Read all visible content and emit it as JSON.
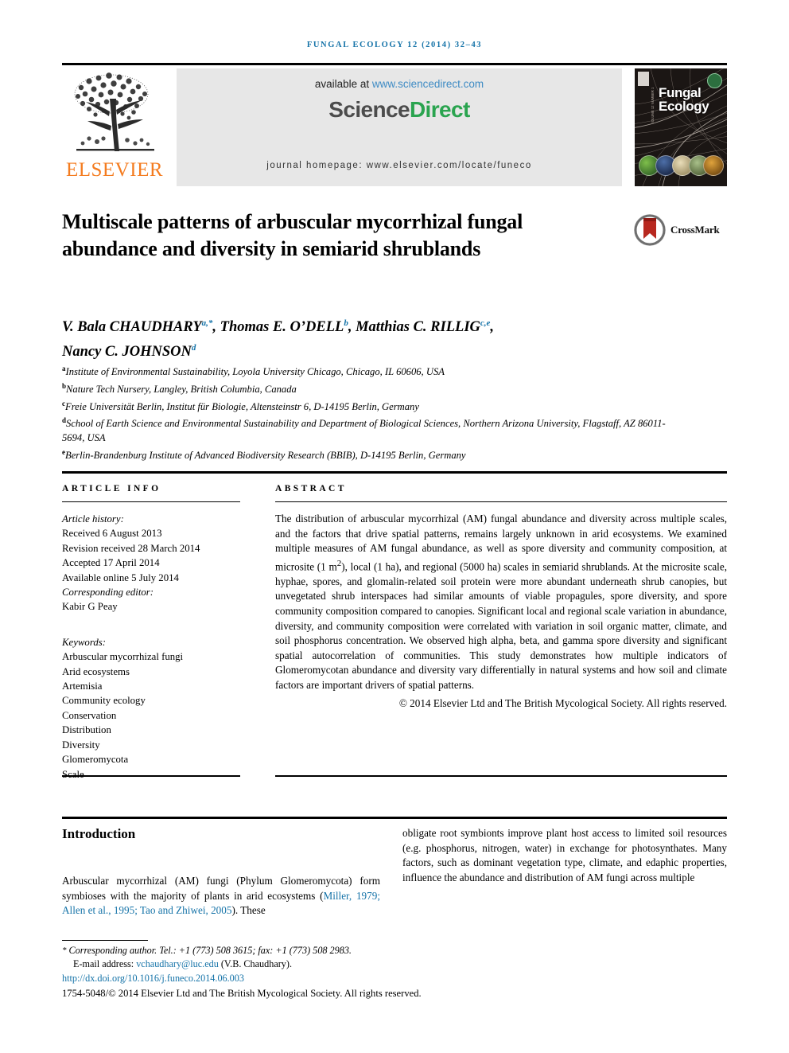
{
  "running_head": "FUNGAL ECOLOGY 12 (2014) 32–43",
  "masthead": {
    "publisher_name": "ELSEVIER",
    "publisher_logo_icon": "elsevier-tree-icon",
    "available_prefix": "available at ",
    "available_url": "www.sciencedirect.com",
    "sciencedirect_part1": "Science",
    "sciencedirect_part2": "Direct",
    "journal_homepage": "journal homepage: www.elsevier.com/locate/funeco",
    "cover": {
      "title_line1": "Fungal",
      "title_line2": "Ecology",
      "spine_text": "VOLUME 12 NUMBER 1 FEBRUARY 2014",
      "publisher_mark_icon": "elsevier-mark-icon",
      "society_badge_icon": "bms-badge-icon"
    },
    "colors": {
      "link": "#3e8bc4",
      "sciencedirect_green": "#2aa44f",
      "elsevier_orange": "#f47c20",
      "panel_bg": "#e7e7e7",
      "running_head": "#1573a8"
    }
  },
  "article": {
    "title": "Multiscale patterns of arbuscular mycorrhizal fungal abundance and diversity in semiarid shrublands",
    "crossmark_label": "CrossMark",
    "authors_line1_a": "V. Bala CHAUDHARY",
    "authors_sup_a": "a,*",
    "authors_line1_b": ", Thomas E. O’DELL",
    "authors_sup_b": "b",
    "authors_line1_c": ", Matthias C. RILLIG",
    "authors_sup_c": "c,e",
    "authors_line1_d": ",",
    "authors_line2": "Nancy C. JOHNSON",
    "authors_sup_d": "d",
    "affiliations": [
      {
        "marker": "a",
        "text": "Institute of Environmental Sustainability, Loyola University Chicago, Chicago, IL 60606, USA"
      },
      {
        "marker": "b",
        "text": "Nature Tech Nursery, Langley, British Columbia, Canada"
      },
      {
        "marker": "c",
        "text": "Freie Universität Berlin, Institut für Biologie, Altensteinstr 6, D-14195 Berlin, Germany"
      },
      {
        "marker": "d",
        "text": "School of Earth Science and Environmental Sustainability and Department of Biological Sciences, Northern Arizona University, Flagstaff, AZ 86011-5694, USA"
      },
      {
        "marker": "e",
        "text": "Berlin-Brandenburg Institute of Advanced Biodiversity Research (BBIB), D-14195 Berlin, Germany"
      }
    ]
  },
  "article_info": {
    "heading": "ARTICLE INFO",
    "history_label": "Article history:",
    "history": [
      "Received 6 August 2013",
      "Revision received 28 March 2014",
      "Accepted 17 April 2014",
      "Available online 5 July 2014"
    ],
    "corresponding_editor_label": "Corresponding editor:",
    "corresponding_editor": "Kabir G Peay",
    "keywords_label": "Keywords:",
    "keywords": [
      "Arbuscular mycorrhizal fungi",
      "Arid ecosystems",
      "Artemisia",
      "Community ecology",
      "Conservation",
      "Distribution",
      "Diversity",
      "Glomeromycota",
      "Scale"
    ]
  },
  "abstract": {
    "heading": "ABSTRACT",
    "p1_part1": "The distribution of arbuscular mycorrhizal (AM) fungal abundance and diversity across multiple scales, and the factors that drive spatial patterns, remains largely unknown in arid ecosystems. We examined multiple measures of AM fungal abundance, as well as spore diversity and community composition, at microsite (1 m",
    "p1_sup1": "2",
    "p1_part2": "), local (1 ha), and regional (5000 ha) scales in semiarid shrublands. At the microsite scale, hyphae, spores, and glomalin-related soil protein were more abundant underneath shrub canopies, but unvegetated shrub interspaces had similar amounts of viable propagules, spore diversity, and spore community composition compared to canopies. Significant local and regional scale variation in abundance, diversity, and community composition were correlated with variation in soil organic matter, climate, and soil phosphorus concentration. We observed high alpha, beta, and gamma spore diversity and significant spatial autocorrelation of communities. This study demonstrates how multiple indicators of Glomeromycotan abundance and diversity vary differentially in natural systems and how soil and climate factors are important drivers of spatial patterns.",
    "copyright": "© 2014 Elsevier Ltd and The British Mycological Society. All rights reserved."
  },
  "introduction": {
    "heading": "Introduction",
    "left_part1": "Arbuscular mycorrhizal (AM) fungi (Phylum Glomeromycota) form symbioses with the majority of plants in arid ecosystems (",
    "left_citation": "Miller, 1979; Allen et al., 1995; Tao and Zhiwei, 2005",
    "left_part2": "). These",
    "right_text": "obligate root symbionts improve plant host access to limited soil resources (e.g. phosphorus, nitrogen, water) in exchange for photosynthates. Many factors, such as dominant vegetation type, climate, and edaphic properties, influence the abundance and distribution of AM fungi across multiple"
  },
  "footer": {
    "corresponding_star": "*",
    "corresponding_author": "Corresponding author. Tel.: +1 (773) 508 3615; fax: +1 (773) 508 2983.",
    "email_label": "E-mail address: ",
    "email": "vchaudhary@luc.edu",
    "email_suffix": " (V.B. Chaudhary).",
    "doi": "http://dx.doi.org/10.1016/j.funeco.2014.06.003",
    "issn_line": "1754-5048/© 2014 Elsevier Ltd and The British Mycological Society. All rights reserved."
  }
}
